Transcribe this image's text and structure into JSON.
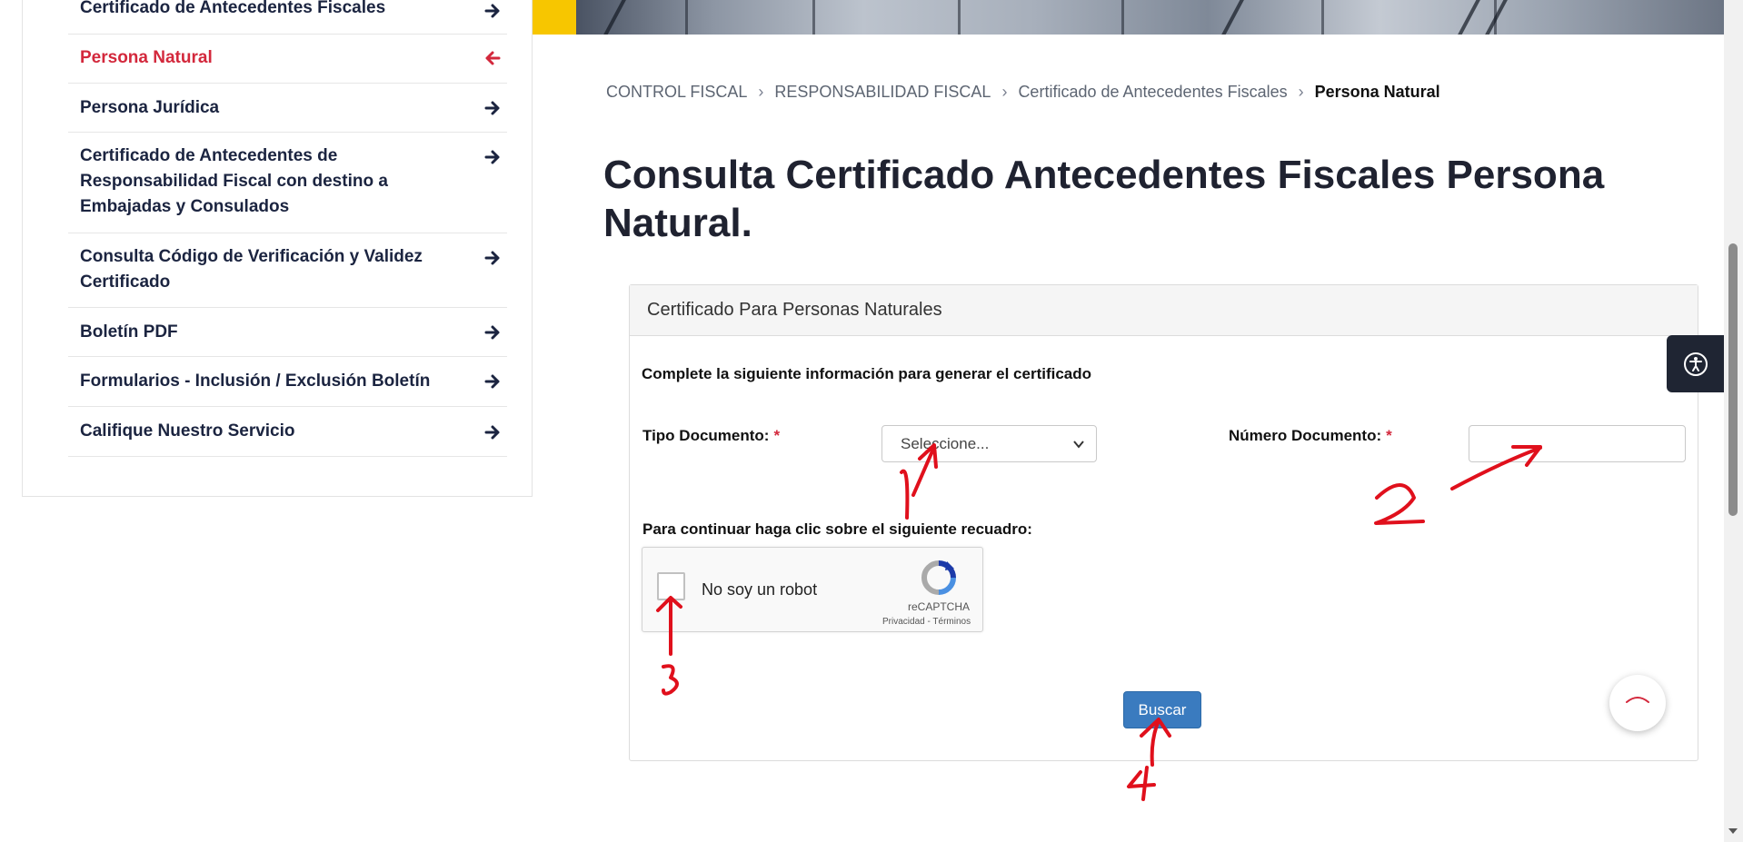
{
  "sidebar": {
    "items": [
      {
        "label": "Certificado de Antecedentes Fiscales",
        "icon": "arrow-right-icon"
      },
      {
        "label": "Persona Natural",
        "icon": "arrow-left-icon",
        "active": true
      },
      {
        "label": "Persona Jurídica",
        "icon": "arrow-right-icon"
      },
      {
        "label": "Certificado de Antecedentes de Responsabilidad Fiscal con destino a Embajadas y Consulados",
        "icon": "arrow-right-icon"
      },
      {
        "label": "Consulta Código de Verificación y Validez Certificado",
        "icon": "arrow-right-icon"
      },
      {
        "label": "Boletín PDF",
        "icon": "arrow-right-icon"
      },
      {
        "label": "Formularios - Inclusión / Exclusión Boletín",
        "icon": "arrow-right-icon"
      },
      {
        "label": "Califique Nuestro Servicio",
        "icon": "arrow-right-icon"
      }
    ]
  },
  "breadcrumb": {
    "items": [
      "CONTROL FISCAL",
      "RESPONSABILIDAD FISCAL",
      "Certificado de Antecedentes Fiscales"
    ],
    "separator": "›",
    "current": "Persona Natural"
  },
  "page_title": "Consulta Certificado Antecedentes Fiscales Persona Natural.",
  "form": {
    "panel_title": "Certificado Para Personas Naturales",
    "instructions": "Complete la siguiente información para generar el certificado",
    "tipo_documento_label": "Tipo Documento:",
    "tipo_documento_value": "Seleccione...",
    "numero_documento_label": "Número Documento:",
    "numero_documento_value": "",
    "required_mark": "*",
    "captcha_prompt": "Para continuar haga clic sobre el siguiente recuadro:",
    "captcha_label": "No soy un robot",
    "captcha_brand": "reCAPTCHA",
    "captcha_links": "Privacidad - Términos",
    "submit_label": "Buscar"
  },
  "annotations": [
    "1",
    "2",
    "3",
    "4"
  ],
  "colors": {
    "accent_red": "#d3283c",
    "navy": "#1b2440",
    "button_blue": "#3a7bbf",
    "yellow": "#f7c600",
    "annotation_red": "#e0101c"
  },
  "icons": {
    "accessibility": "accessibility-icon",
    "scroll_top": "chevron-up-icon",
    "select_chevron": "chevron-down-icon"
  }
}
